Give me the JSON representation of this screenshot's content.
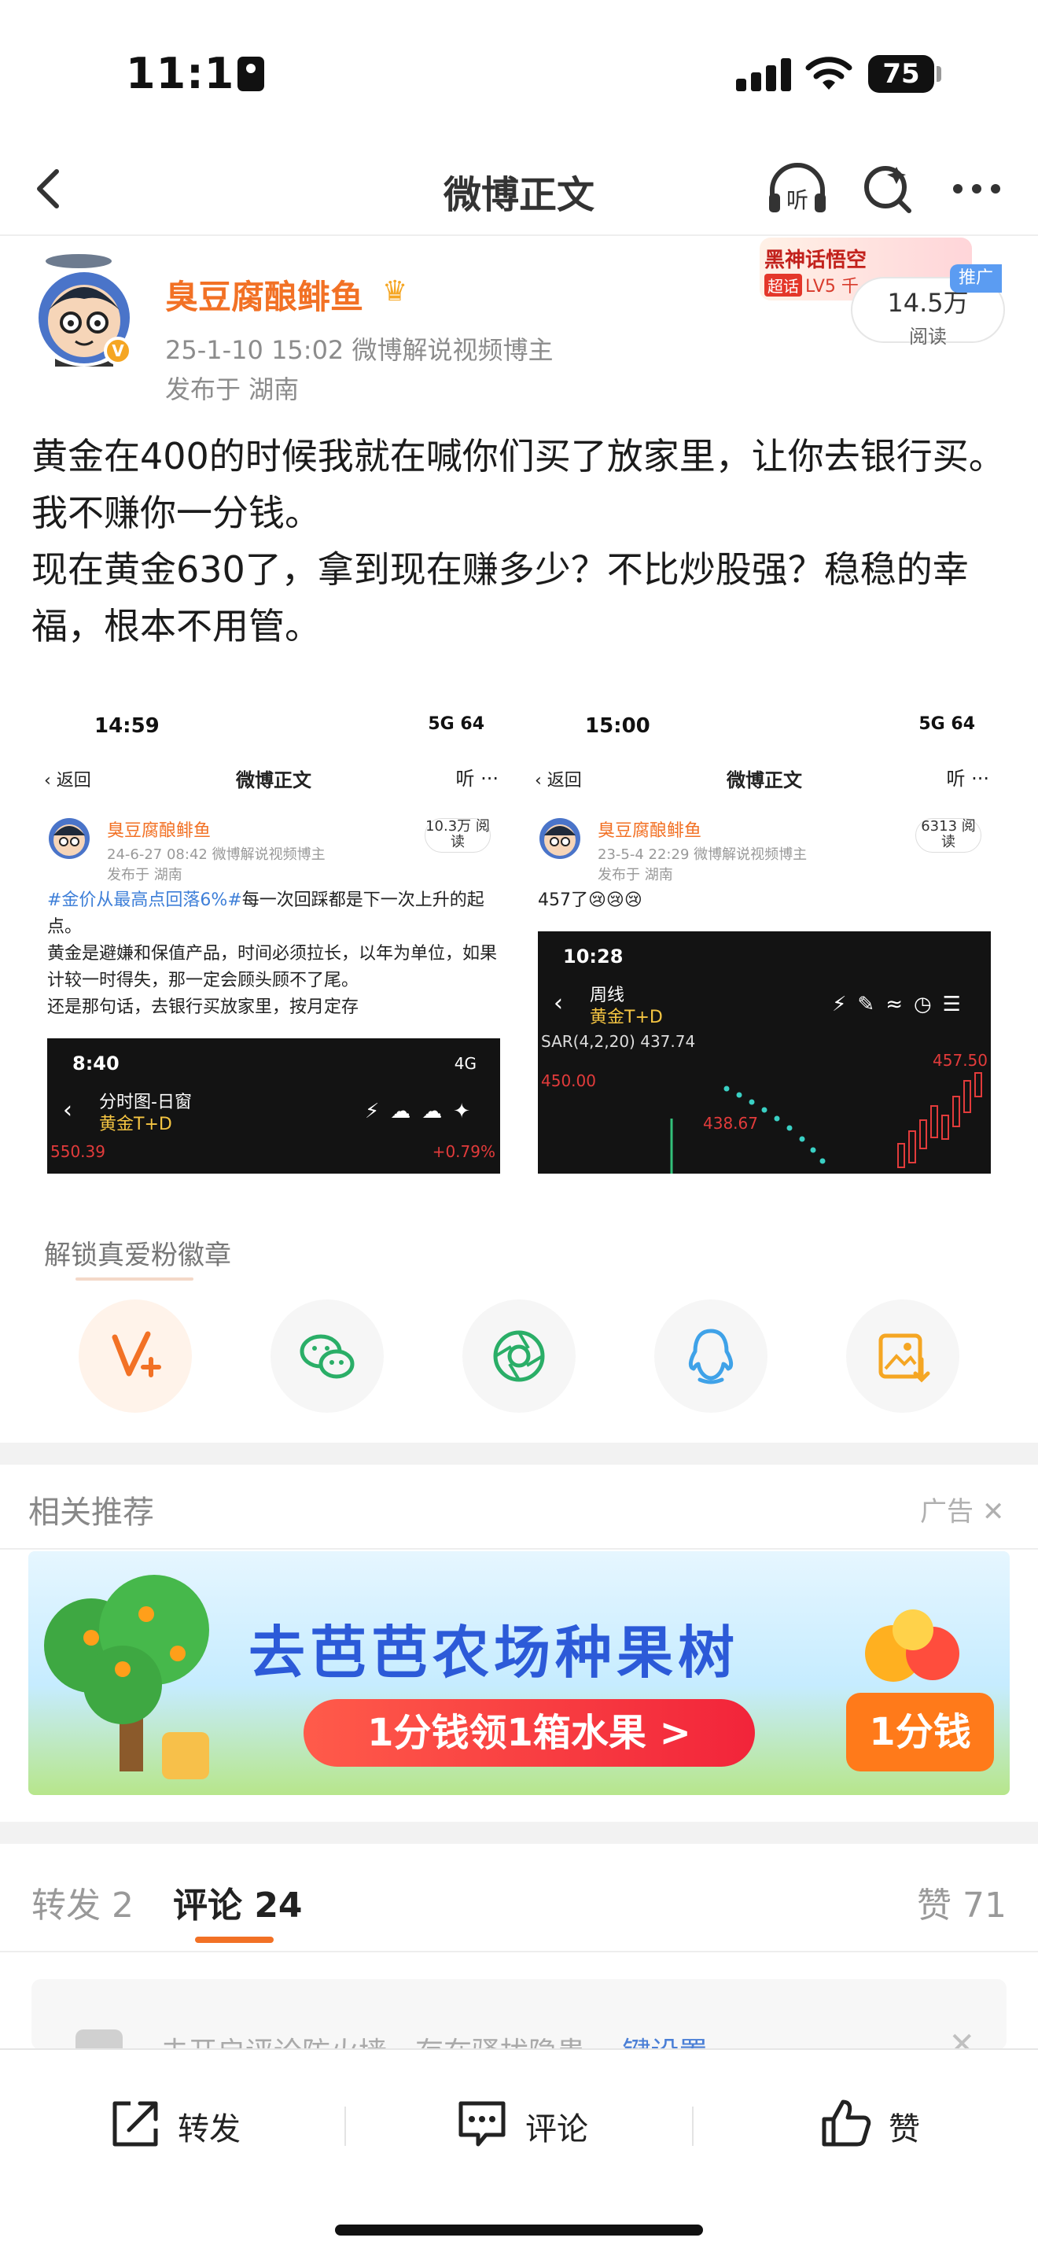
{
  "status_bar": {
    "time": "11:11",
    "battery": "75"
  },
  "nav": {
    "title": "微博正文",
    "listen_label": "听"
  },
  "post": {
    "author": "臭豆腐酿鲱鱼",
    "avatar_badge": "V",
    "meta": "25-1-10 15:02  微博解说视频博主",
    "location": "发布于 湖南",
    "promo_line1": "黑神话悟空",
    "promo_tag": "超话",
    "promo_line2": "LV5 千",
    "promo_ad": "推广",
    "reads_count": "14.5万",
    "reads_unit": "阅读",
    "text": "黄金在400的时候我就在喊你们买了放家里，让你去银行买。我不赚你一分钱。\n现在黄金630了，拿到现在赚多少？不比炒股强？稳稳的幸福，根本不用管。"
  },
  "embedded": [
    {
      "time": "14:59",
      "status": "5G 64",
      "back": "返回",
      "title": "微博正文",
      "icons": "听 ···",
      "user": "臭豆腐酿鲱鱼",
      "meta": "24-6-27 08:42  微博解说视频博主",
      "location": "发布于 湖南",
      "reads": "10.3万 阅读",
      "hashtag": "#金价从最高点回落6%#",
      "text": "每一次回踩都是下一次上升的起点。\n黄金是避嫌和保值产品，时间必须拉长，以年为单位，如果计较一时得失，那一定会顾头顾不了尾。\n还是那句话，去银行买放家里，按月定存",
      "inner_time": "8:40",
      "inner_status": "4G",
      "inner_title": "分时图-日窗",
      "inner_sub": "黄金T+D",
      "price_left": "550.39",
      "price_right": "+0.79%"
    },
    {
      "time": "15:00",
      "status": "5G 64",
      "back": "返回",
      "title": "微博正文",
      "icons": "听 ···",
      "user": "臭豆腐酿鲱鱼",
      "meta": "23-5-4 22:29  微博解说视频博主",
      "location": "发布于 湖南",
      "reads": "6313 阅读",
      "text": "457了😢😢😢",
      "inner_time": "10:28",
      "inner_title": "周线",
      "inner_sub": "黄金T+D",
      "sar": "SAR(4,2,20)  437.74",
      "price_a": "450.00",
      "price_b": "438.67",
      "price_c": "457.50"
    }
  ],
  "share": {
    "unlock_label": "解锁真爱粉徽章"
  },
  "related": {
    "title": "相关推荐",
    "ad_label": "广告",
    "banner_title": "去芭芭农场种果树",
    "banner_pill": "1分钱领1箱水果 >",
    "banner_fee": "1分钱"
  },
  "tabs": {
    "repost": "转发 2",
    "comment": "评论 24",
    "like": "赞 71"
  },
  "notice": {
    "text": "未开启评论防火墙，存在骚扰隐患 ",
    "link": "一键设置"
  },
  "bottom_bar": {
    "repost": "转发",
    "comment": "评论",
    "like": "赞"
  }
}
